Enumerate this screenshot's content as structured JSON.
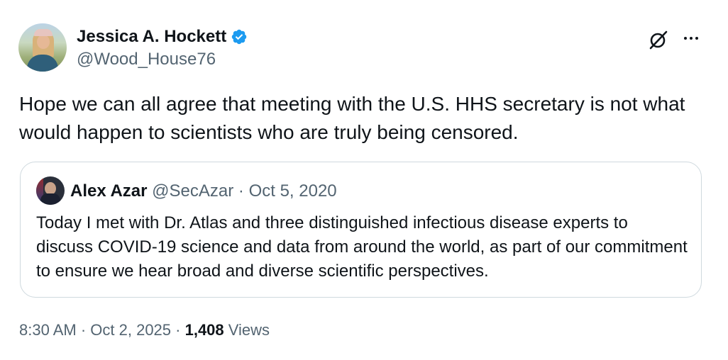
{
  "author": {
    "display_name": "Jessica A. Hockett",
    "handle": "@Wood_House76",
    "verified": true
  },
  "tweet": {
    "text": "Hope we can all agree that meeting with the U.S. HHS secretary is not what would happen to scientists who are truly being censored."
  },
  "quoted_tweet": {
    "display_name": "Alex Azar",
    "handle": "@SecAzar",
    "separator": " · ",
    "date": "Oct 5, 2020",
    "text": "Today I met with Dr. Atlas and three distinguished infectious disease experts to discuss COVID-19 science and data from around the world, as part of our commitment to ensure we hear broad and diverse scientific perspectives."
  },
  "footer": {
    "time": "8:30 AM",
    "sep1": " · ",
    "date": "Oct 2, 2025",
    "sep2": " · ",
    "views_count": "1,408",
    "views_label": " Views"
  },
  "icons": {
    "verified": "verified-badge-icon",
    "grok": "grok-icon",
    "more": "more-icon"
  },
  "colors": {
    "verified_blue": "#1d9bf0",
    "text_primary": "#0f1419",
    "text_secondary": "#536471",
    "border": "#cfd9de"
  }
}
